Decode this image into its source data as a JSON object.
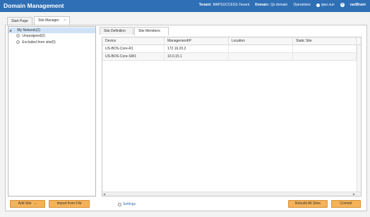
{
  "header": {
    "title": "Domain Management",
    "tenant_label": "Tenant:",
    "tenant_value": "MAPSUCCESS-Tenant",
    "domain_label": "Domain:",
    "domain_value": "Qs domain",
    "operations": "Operations",
    "user": "qian.sun",
    "help": "?",
    "brand": "netBrain"
  },
  "page_tabs": [
    {
      "label": "Start Page"
    },
    {
      "label": "Site Manager",
      "close": "×"
    }
  ],
  "tree": {
    "root": {
      "toggle": "◢",
      "label": "My Network(2)"
    },
    "children": [
      {
        "icon": "+",
        "label": "Unassigned(2)"
      },
      {
        "icon": "+",
        "label": "Excluded from site(0)"
      }
    ]
  },
  "left_buttons": {
    "add_site": "Add Site",
    "add_site_chevron": "⌵",
    "import_from_file": "Import from File"
  },
  "settings_label": "Settings",
  "sub_tabs": [
    {
      "label": "Site Definition"
    },
    {
      "label": "Site Members"
    }
  ],
  "grid": {
    "columns": [
      "Device",
      "ManagementIP",
      "Location",
      "Static Site"
    ],
    "rows": [
      [
        "US-BOS-Core-R1",
        "172.16.20.2",
        "",
        ""
      ],
      [
        "US-BOS-Core-SW1",
        "10.0.15.1",
        "",
        ""
      ]
    ]
  },
  "right_buttons": {
    "rebuild_all_sites": "Rebuild All Sites",
    "commit": "Commit"
  },
  "colors": {
    "header_bg": "#2f6fb5",
    "button_orange": "#f4b35a",
    "selected_tree_row": "#cfe3f7"
  }
}
